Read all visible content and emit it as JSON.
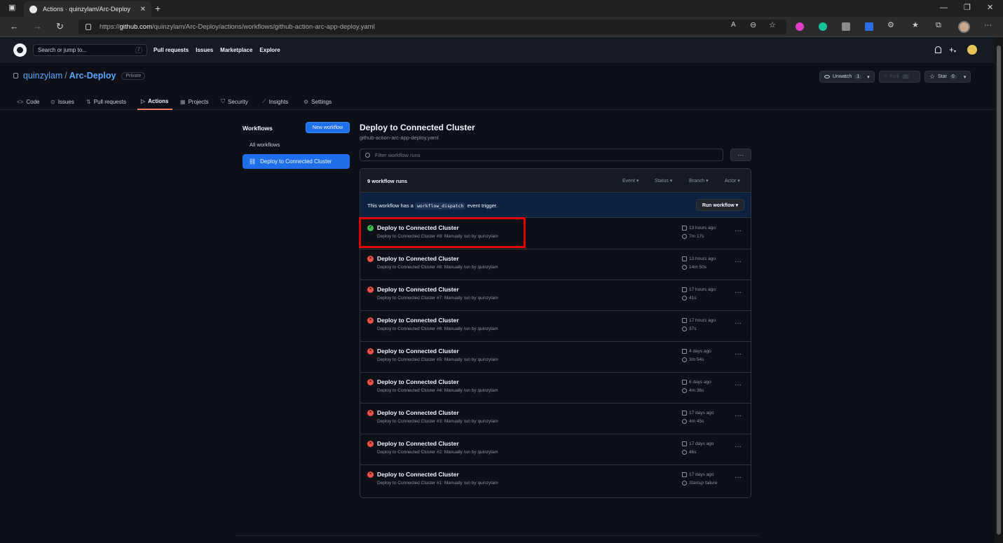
{
  "browser": {
    "tab_title": "Actions · quinzylam/Arc-Deploy",
    "tab_close": "✕",
    "new_tab": "+",
    "url_prefix": "https://",
    "url_host": "github.com",
    "url_path": "/quinzylam/Arc-Deploy/actions/workflows/github-action-arc-app-deploy.yaml",
    "window_controls": [
      "—",
      "❐",
      "✕"
    ]
  },
  "gh_header": {
    "search_placeholder": "Search or jump to...",
    "search_key": "/",
    "nav": [
      "Pull requests",
      "Issues",
      "Marketplace",
      "Explore"
    ]
  },
  "repo": {
    "owner": "quinzylam",
    "separator": "/",
    "name": "Arc-Deploy",
    "visibility": "Private",
    "watch_label": "Unwatch",
    "watch_count": "1",
    "fork_label": "Fork",
    "fork_count": "0",
    "star_label": "Star",
    "star_count": "0"
  },
  "repo_tabs": [
    {
      "label": "Code",
      "icon": "<>"
    },
    {
      "label": "Issues",
      "icon": "⊙"
    },
    {
      "label": "Pull requests",
      "icon": "⇅"
    },
    {
      "label": "Actions",
      "icon": "▷"
    },
    {
      "label": "Projects",
      "icon": "▦"
    },
    {
      "label": "Security",
      "icon": "⛉"
    },
    {
      "label": "Insights",
      "icon": "⟋"
    },
    {
      "label": "Settings",
      "icon": "⚙"
    }
  ],
  "sidebar": {
    "heading": "Workflows",
    "new_workflow": "New workflow",
    "all_workflows": "All workflows",
    "active_workflow": "Deploy to Connected Cluster"
  },
  "main": {
    "title": "Deploy to Connected Cluster",
    "file": "github-action-arc-app-deploy.yaml",
    "filter_placeholder": "Filter workflow runs",
    "more": "···",
    "runs_count": "9 workflow runs",
    "filters": [
      "Event ▾",
      "Status ▾",
      "Branch ▾",
      "Actor ▾"
    ],
    "notice_before": "This workflow has a",
    "notice_code": "workflow_dispatch",
    "notice_after": "event trigger.",
    "run_workflow": "Run workflow ▾"
  },
  "runs": [
    {
      "status": "success",
      "title": "Deploy to Connected Cluster",
      "sub": "Deploy to Connected Cluster #9: Manually run by quinzylam",
      "time": "13 hours ago",
      "duration": "7m 17s"
    },
    {
      "status": "failure",
      "title": "Deploy to Connected Cluster",
      "sub": "Deploy to Connected Cluster #8: Manually run by quinzylam",
      "time": "13 hours ago",
      "duration": "14m 50s"
    },
    {
      "status": "failure",
      "title": "Deploy to Connected Cluster",
      "sub": "Deploy to Connected Cluster #7: Manually run by quinzylam",
      "time": "17 hours ago",
      "duration": "41s"
    },
    {
      "status": "failure",
      "title": "Deploy to Connected Cluster",
      "sub": "Deploy to Connected Cluster #6: Manually run by quinzylam",
      "time": "17 hours ago",
      "duration": "37s"
    },
    {
      "status": "failure",
      "title": "Deploy to Connected Cluster",
      "sub": "Deploy to Connected Cluster #5: Manually run by quinzylam",
      "time": "4 days ago",
      "duration": "3m 54s"
    },
    {
      "status": "failure",
      "title": "Deploy to Connected Cluster",
      "sub": "Deploy to Connected Cluster #4: Manually run by quinzylam",
      "time": "6 days ago",
      "duration": "4m 36s"
    },
    {
      "status": "failure",
      "title": "Deploy to Connected Cluster",
      "sub": "Deploy to Connected Cluster #3: Manually run by quinzylam",
      "time": "17 days ago",
      "duration": "4m 45s"
    },
    {
      "status": "failure",
      "title": "Deploy to Connected Cluster",
      "sub": "Deploy to Connected Cluster #2: Manually run by quinzylam",
      "time": "17 days ago",
      "duration": "46s"
    },
    {
      "status": "failure",
      "title": "Deploy to Connected Cluster",
      "sub": "Deploy to Connected Cluster #1: Manually run by quinzylam",
      "time": "17 days ago",
      "duration": "Startup failure"
    }
  ],
  "colors": {
    "success": "#3fb950",
    "failure": "#f85149",
    "accent": "#1f6feb",
    "highlight_box": "#e00000"
  }
}
